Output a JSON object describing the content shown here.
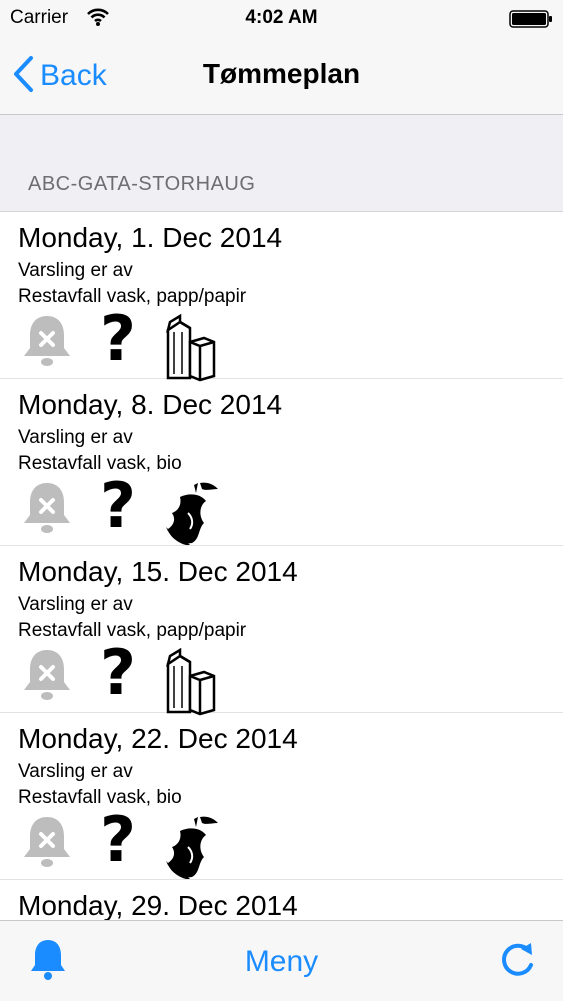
{
  "status_bar": {
    "carrier": "Carrier",
    "time": "4:02 AM"
  },
  "nav": {
    "back_label": "Back",
    "title": "Tømmeplan"
  },
  "section": {
    "label": "ABC-GATA-STORHAUG"
  },
  "rows": [
    {
      "date": "Monday, 1. Dec 2014",
      "notify": "Varsling er av",
      "type": "Restavfall vask, papp/papir",
      "waste_icon": "paper-carton-icon"
    },
    {
      "date": "Monday, 8. Dec 2014",
      "notify": "Varsling er av",
      "type": "Restavfall vask, bio",
      "waste_icon": "apple-core-icon"
    },
    {
      "date": "Monday, 15. Dec 2014",
      "notify": "Varsling er av",
      "type": "Restavfall vask, papp/papir",
      "waste_icon": "paper-carton-icon"
    },
    {
      "date": "Monday, 22. Dec 2014",
      "notify": "Varsling er av",
      "type": "Restavfall vask, bio",
      "waste_icon": "apple-core-icon"
    },
    {
      "date": "Monday, 29. Dec 2014",
      "notify": "",
      "type": "",
      "waste_icon": ""
    }
  ],
  "tab_bar": {
    "menu_label": "Meny"
  },
  "colors": {
    "accent": "#1a8cff",
    "muted_icon": "#bdbdbd",
    "section_bg": "#efeff4"
  }
}
